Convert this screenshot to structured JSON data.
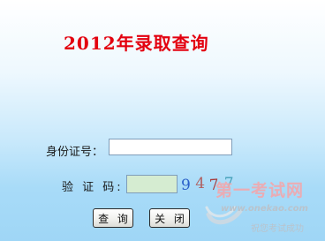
{
  "page": {
    "title": "2012年录取查询"
  },
  "form": {
    "id_label": "身份证号：",
    "id_value": "",
    "code_label": "验 证 码:",
    "code_value": "",
    "captcha_digits": [
      "9",
      "4",
      "7",
      "7"
    ]
  },
  "buttons": {
    "query_label": "查 询",
    "close_label": "关 闭"
  },
  "watermark": {
    "title": "第一考试网",
    "url": "www.onekao.com",
    "slogan": "祝您考试成功"
  },
  "colors": {
    "title": "#e3000f",
    "code_input_bg": "#d5ecd1",
    "background_bottom": "#9fd6f6"
  }
}
